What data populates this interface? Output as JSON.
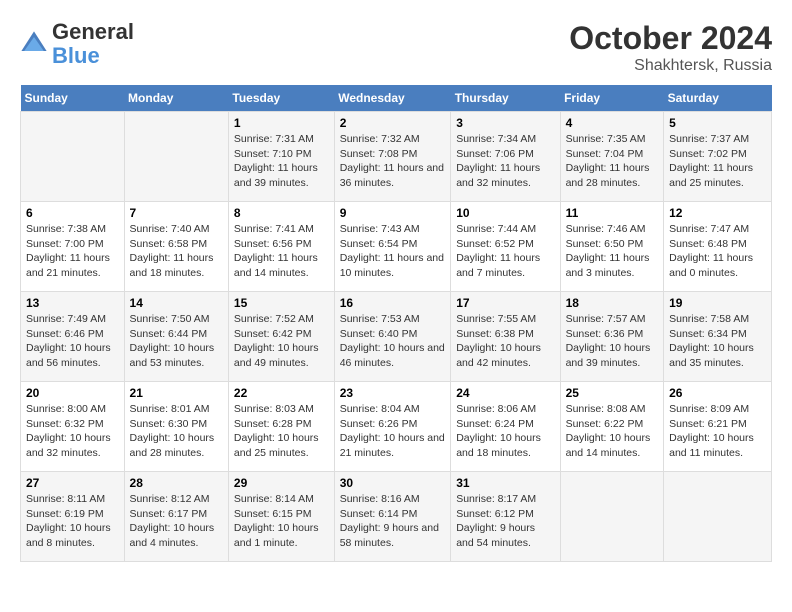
{
  "logo": {
    "text_general": "General",
    "text_blue": "Blue"
  },
  "title": "October 2024",
  "subtitle": "Shakhtersk, Russia",
  "days_of_week": [
    "Sunday",
    "Monday",
    "Tuesday",
    "Wednesday",
    "Thursday",
    "Friday",
    "Saturday"
  ],
  "weeks": [
    [
      {
        "day": "",
        "content": ""
      },
      {
        "day": "",
        "content": ""
      },
      {
        "day": "1",
        "content": "Sunrise: 7:31 AM\nSunset: 7:10 PM\nDaylight: 11 hours and 39 minutes."
      },
      {
        "day": "2",
        "content": "Sunrise: 7:32 AM\nSunset: 7:08 PM\nDaylight: 11 hours and 36 minutes."
      },
      {
        "day": "3",
        "content": "Sunrise: 7:34 AM\nSunset: 7:06 PM\nDaylight: 11 hours and 32 minutes."
      },
      {
        "day": "4",
        "content": "Sunrise: 7:35 AM\nSunset: 7:04 PM\nDaylight: 11 hours and 28 minutes."
      },
      {
        "day": "5",
        "content": "Sunrise: 7:37 AM\nSunset: 7:02 PM\nDaylight: 11 hours and 25 minutes."
      }
    ],
    [
      {
        "day": "6",
        "content": "Sunrise: 7:38 AM\nSunset: 7:00 PM\nDaylight: 11 hours and 21 minutes."
      },
      {
        "day": "7",
        "content": "Sunrise: 7:40 AM\nSunset: 6:58 PM\nDaylight: 11 hours and 18 minutes."
      },
      {
        "day": "8",
        "content": "Sunrise: 7:41 AM\nSunset: 6:56 PM\nDaylight: 11 hours and 14 minutes."
      },
      {
        "day": "9",
        "content": "Sunrise: 7:43 AM\nSunset: 6:54 PM\nDaylight: 11 hours and 10 minutes."
      },
      {
        "day": "10",
        "content": "Sunrise: 7:44 AM\nSunset: 6:52 PM\nDaylight: 11 hours and 7 minutes."
      },
      {
        "day": "11",
        "content": "Sunrise: 7:46 AM\nSunset: 6:50 PM\nDaylight: 11 hours and 3 minutes."
      },
      {
        "day": "12",
        "content": "Sunrise: 7:47 AM\nSunset: 6:48 PM\nDaylight: 11 hours and 0 minutes."
      }
    ],
    [
      {
        "day": "13",
        "content": "Sunrise: 7:49 AM\nSunset: 6:46 PM\nDaylight: 10 hours and 56 minutes."
      },
      {
        "day": "14",
        "content": "Sunrise: 7:50 AM\nSunset: 6:44 PM\nDaylight: 10 hours and 53 minutes."
      },
      {
        "day": "15",
        "content": "Sunrise: 7:52 AM\nSunset: 6:42 PM\nDaylight: 10 hours and 49 minutes."
      },
      {
        "day": "16",
        "content": "Sunrise: 7:53 AM\nSunset: 6:40 PM\nDaylight: 10 hours and 46 minutes."
      },
      {
        "day": "17",
        "content": "Sunrise: 7:55 AM\nSunset: 6:38 PM\nDaylight: 10 hours and 42 minutes."
      },
      {
        "day": "18",
        "content": "Sunrise: 7:57 AM\nSunset: 6:36 PM\nDaylight: 10 hours and 39 minutes."
      },
      {
        "day": "19",
        "content": "Sunrise: 7:58 AM\nSunset: 6:34 PM\nDaylight: 10 hours and 35 minutes."
      }
    ],
    [
      {
        "day": "20",
        "content": "Sunrise: 8:00 AM\nSunset: 6:32 PM\nDaylight: 10 hours and 32 minutes."
      },
      {
        "day": "21",
        "content": "Sunrise: 8:01 AM\nSunset: 6:30 PM\nDaylight: 10 hours and 28 minutes."
      },
      {
        "day": "22",
        "content": "Sunrise: 8:03 AM\nSunset: 6:28 PM\nDaylight: 10 hours and 25 minutes."
      },
      {
        "day": "23",
        "content": "Sunrise: 8:04 AM\nSunset: 6:26 PM\nDaylight: 10 hours and 21 minutes."
      },
      {
        "day": "24",
        "content": "Sunrise: 8:06 AM\nSunset: 6:24 PM\nDaylight: 10 hours and 18 minutes."
      },
      {
        "day": "25",
        "content": "Sunrise: 8:08 AM\nSunset: 6:22 PM\nDaylight: 10 hours and 14 minutes."
      },
      {
        "day": "26",
        "content": "Sunrise: 8:09 AM\nSunset: 6:21 PM\nDaylight: 10 hours and 11 minutes."
      }
    ],
    [
      {
        "day": "27",
        "content": "Sunrise: 8:11 AM\nSunset: 6:19 PM\nDaylight: 10 hours and 8 minutes."
      },
      {
        "day": "28",
        "content": "Sunrise: 8:12 AM\nSunset: 6:17 PM\nDaylight: 10 hours and 4 minutes."
      },
      {
        "day": "29",
        "content": "Sunrise: 8:14 AM\nSunset: 6:15 PM\nDaylight: 10 hours and 1 minute."
      },
      {
        "day": "30",
        "content": "Sunrise: 8:16 AM\nSunset: 6:14 PM\nDaylight: 9 hours and 58 minutes."
      },
      {
        "day": "31",
        "content": "Sunrise: 8:17 AM\nSunset: 6:12 PM\nDaylight: 9 hours and 54 minutes."
      },
      {
        "day": "",
        "content": ""
      },
      {
        "day": "",
        "content": ""
      }
    ]
  ]
}
